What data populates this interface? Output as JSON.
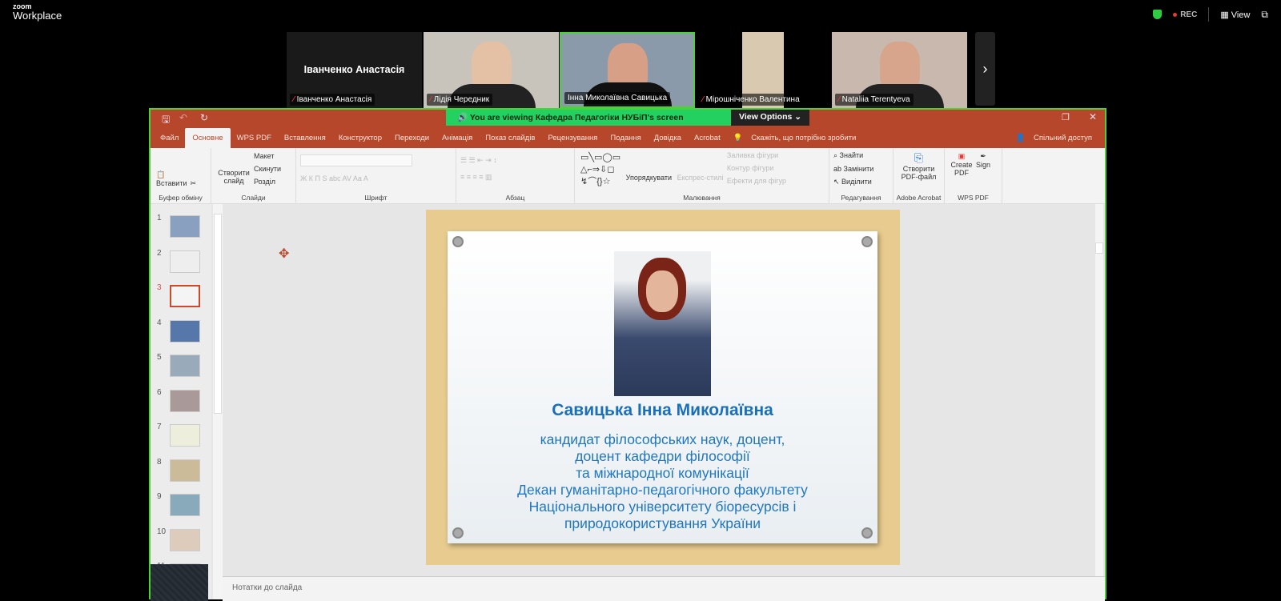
{
  "app": {
    "logo_line1": "zoom",
    "logo_line2": "Workplace",
    "rec": "REC",
    "view": "View"
  },
  "participants": [
    {
      "name": "Іванченко Анастасія",
      "display": "Іванченко Анастасія",
      "muted": true,
      "video": false
    },
    {
      "name": "Лідія Чередник",
      "muted": true,
      "video": true
    },
    {
      "name": "Інна Миколаївна Савицька",
      "muted": false,
      "video": true,
      "active_speaker": true
    },
    {
      "name": "Мірошніченко Валентина",
      "muted": true,
      "video": true
    },
    {
      "name": "Nataliia Terentyeva",
      "muted": true,
      "video": true
    }
  ],
  "banner": {
    "viewing": "You are viewing  Кафедра Педагогіки НУБіП's screen",
    "view_options": "View Options"
  },
  "ppt": {
    "tabs": [
      "Файл",
      "Основне",
      "WPS PDF",
      "Вставлення",
      "Конструктор",
      "Переходи",
      "Анімація",
      "Показ слайдів",
      "Рецензування",
      "Подання",
      "Довідка",
      "Acrobat"
    ],
    "active_tab": "Основне",
    "tell_me": "Скажіть, що потрібно зробити",
    "share": "Спільний доступ",
    "groups": {
      "clipboard": {
        "label": "Буфер обміну",
        "paste": "Вставити"
      },
      "slides": {
        "label": "Слайди",
        "new": "Створити слайд",
        "layout": "Макет",
        "reset": "Скинути",
        "section": "Розділ"
      },
      "font": {
        "label": "Шрифт"
      },
      "paragraph": {
        "label": "Абзац"
      },
      "drawing": {
        "label": "Малювання",
        "arrange": "Упорядкувати",
        "styles": "Експрес-стилі",
        "fill": "Заливка фігури",
        "outline": "Контур фігури",
        "effects": "Ефекти для фігур"
      },
      "editing": {
        "label": "Редагування",
        "find": "Знайти",
        "replace": "Замінити",
        "select": "Виділити"
      },
      "acrobat": {
        "label": "Adobe Acrobat",
        "create": "Створити PDF-файл"
      },
      "wps": {
        "label": "WPS PDF",
        "create": "Create PDF",
        "sign": "Sign"
      }
    },
    "thumbnails": [
      "1",
      "2",
      "3",
      "4",
      "5",
      "6",
      "7",
      "8",
      "9",
      "10",
      "11"
    ],
    "selected_slide": 3,
    "notes_placeholder": "Нотатки до слайда",
    "slide": {
      "title": "Савицька Інна Миколаївна",
      "lines": [
        "кандидат філософських наук, доцент,",
        "доцент кафедри філософії",
        "та міжнародної комунікації",
        "Декан гуманітарно-педагогічного факультету",
        "Національного університету біоресурсів і",
        "природокористування України"
      ]
    }
  }
}
